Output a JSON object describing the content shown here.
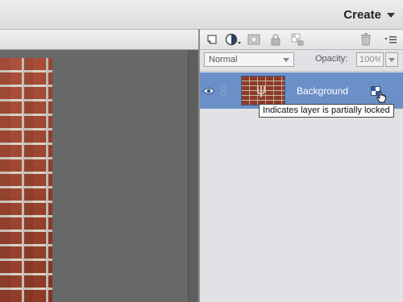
{
  "header": {
    "create_label": "Create"
  },
  "toolbar": {
    "icons": [
      "new-layer-icon",
      "adjustment-layer-icon",
      "layer-mask-icon",
      "lock-all-icon",
      "lock-transparency-icon",
      "delete-layer-icon",
      "panel-menu-icon"
    ]
  },
  "options": {
    "blend_mode": "Normal",
    "opacity_label": "Opacity:",
    "opacity_value": "100%"
  },
  "layer": {
    "name": "Background",
    "selected": true,
    "visible": true
  },
  "tooltip": {
    "text": "Indicates layer is partially locked"
  },
  "colors": {
    "selected_layer": "#6b8fc7",
    "canvas_bg": "#686868",
    "panel_bg": "#e1e2e5"
  }
}
